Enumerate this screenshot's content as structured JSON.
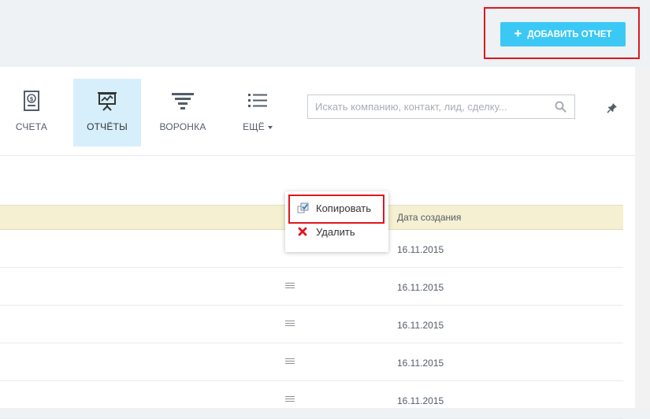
{
  "header": {
    "add_report_label": "ДОБАВИТЬ ОТЧЕТ",
    "add_icon": "plus-icon"
  },
  "nav": {
    "items": [
      {
        "label": "СЧЕТА",
        "icon": "invoice-icon",
        "active": false
      },
      {
        "label": "ОТЧЁТЫ",
        "icon": "presentation-chart-icon",
        "active": true
      },
      {
        "label": "ВОРОНКА",
        "icon": "funnel-icon",
        "active": false
      },
      {
        "label": "ЕЩЁ",
        "icon": "list-icon",
        "active": false
      }
    ]
  },
  "search": {
    "placeholder": "Искать компанию, контакт, лид, сделку...",
    "value": ""
  },
  "table": {
    "columns": [
      "Дата создания"
    ],
    "rows": [
      {
        "date": "16.11.2015"
      },
      {
        "date": "16.11.2015"
      },
      {
        "date": "16.11.2015"
      },
      {
        "date": "16.11.2015"
      },
      {
        "date": "16.11.2015"
      }
    ]
  },
  "context_menu": {
    "items": [
      {
        "label": "Копировать",
        "icon": "copy-icon"
      },
      {
        "label": "Удалить",
        "icon": "delete-x-icon"
      }
    ]
  },
  "colors": {
    "accent": "#3bc8f5",
    "active_tab": "#d6effb",
    "table_header": "#f5f0d1",
    "highlight": "#e0171f",
    "delete": "#e0171f"
  }
}
